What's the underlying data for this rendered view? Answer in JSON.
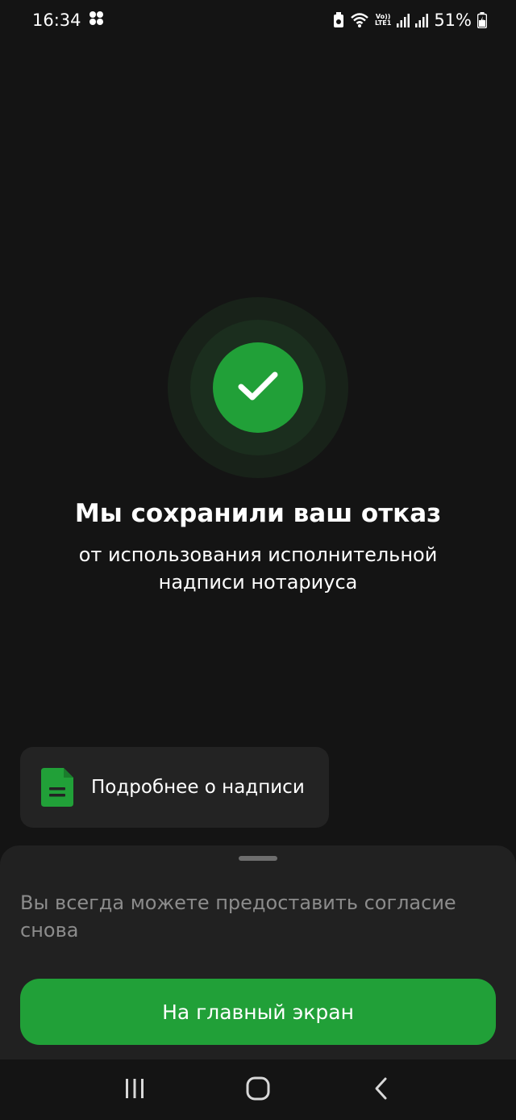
{
  "status_bar": {
    "time": "16:34",
    "battery": "51%",
    "network": "LTE1",
    "volte": "Vo))",
    "icons": [
      "notification-dots-icon",
      "battery-saver-icon",
      "wifi-icon",
      "signal-icon",
      "signal-icon",
      "battery-icon"
    ]
  },
  "success": {
    "icon": "checkmark-icon",
    "title": "Мы сохранили ваш отказ",
    "subtitle": "от использования исполнительной надписи нотариуса"
  },
  "info_card": {
    "icon": "document-icon",
    "label": "Подробнее о надписи"
  },
  "sheet": {
    "text": "Вы всегда можете предоставить согласие снова",
    "button_label": "На главный экран"
  },
  "nav": {
    "items": [
      "recent-apps-icon",
      "home-icon",
      "back-icon"
    ]
  },
  "colors": {
    "background": "#141414",
    "accent": "#21a038",
    "card": "#232323",
    "sheet": "#212121",
    "muted_text": "#8c8c8c"
  }
}
